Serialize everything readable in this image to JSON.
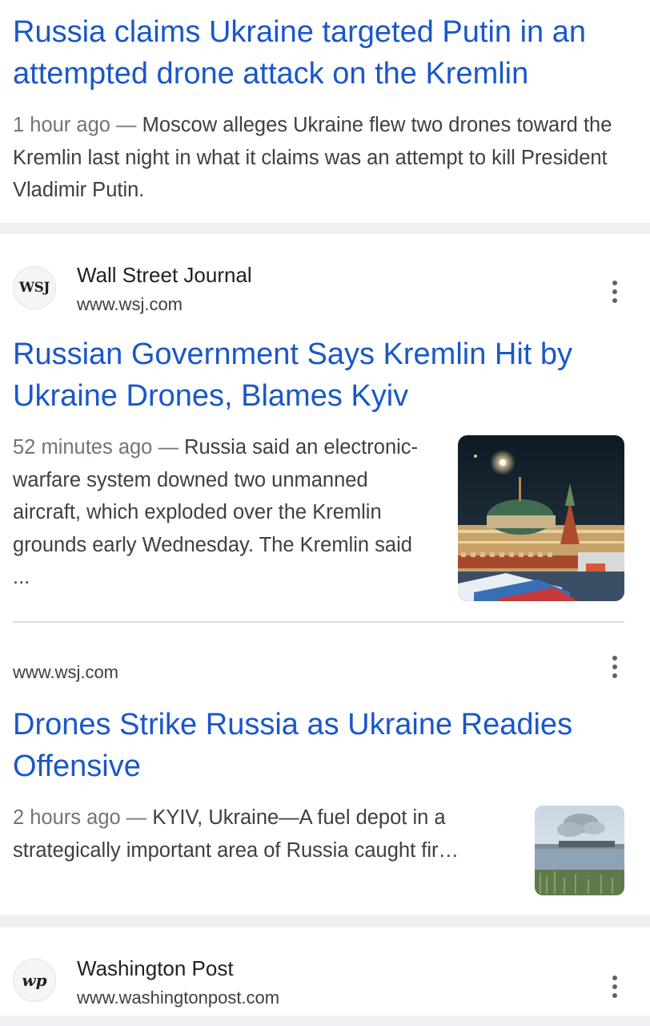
{
  "results": [
    {
      "title": "Russia claims Ukraine targeted Putin in an attempted drone attack on the Kremlin",
      "time": "1 hour ago",
      "snippet": "Moscow alleges Ukraine flew two drones toward the Kremlin last night in what it claims was an attempt to kill President Vladimir Putin."
    },
    {
      "source_name": "Wall Street Journal",
      "favicon_text": "WSJ",
      "url": "www.wsj.com",
      "title": "Russian Government Says Kremlin Hit by Ukraine Drones, Blames Kyiv",
      "time": "52 minutes ago",
      "snippet": "Russia said an electronic-warfare system downed two unmanned aircraft, which exploded over the Kremlin grounds early Wednesday. The Kremlin said ...",
      "thumbnail_icon": "kremlin-night-photo"
    },
    {
      "url": "www.wsj.com",
      "title": "Drones Strike Russia as Ukraine Readies Offensive",
      "time": "2 hours ago",
      "snippet": "KYIV, Ukraine—A fuel depot in a strategically important area of Russia caught fir…",
      "thumbnail_icon": "smoke-over-water-photo"
    },
    {
      "source_name": "Washington Post",
      "favicon_text": "wp",
      "url": "www.washingtonpost.com"
    }
  ],
  "separator": "—",
  "more_icon": "more-vert-icon",
  "colors": {
    "link": "#1a57c9",
    "divider": "#eef0f3"
  }
}
